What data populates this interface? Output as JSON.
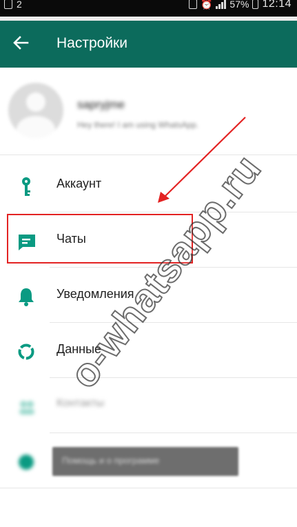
{
  "status_bar": {
    "left_number": "2",
    "battery": "57%",
    "time": "12:14"
  },
  "toolbar": {
    "back_icon": "arrow-left-icon",
    "title": "Настройки"
  },
  "profile": {
    "name": "sapryjme",
    "status": "Hey there! I am using WhatsApp."
  },
  "settings": {
    "items": [
      {
        "label": "Аккаунт",
        "icon": "key-icon"
      },
      {
        "label": "Чаты",
        "icon": "chat-icon"
      },
      {
        "label": "Уведомления",
        "icon": "bell-icon"
      },
      {
        "label": "Данные",
        "icon": "data-usage-icon"
      },
      {
        "label": "Контакты",
        "icon": "contacts-icon"
      },
      {
        "label": "Помощь и о программе",
        "icon": "help-icon"
      }
    ]
  },
  "annotation": {
    "watermark": "o-whatsapp.ru",
    "highlight_color": "#e32222"
  },
  "colors": {
    "toolbar": "#0c6b5c",
    "accent_icon": "#0a9a82"
  }
}
